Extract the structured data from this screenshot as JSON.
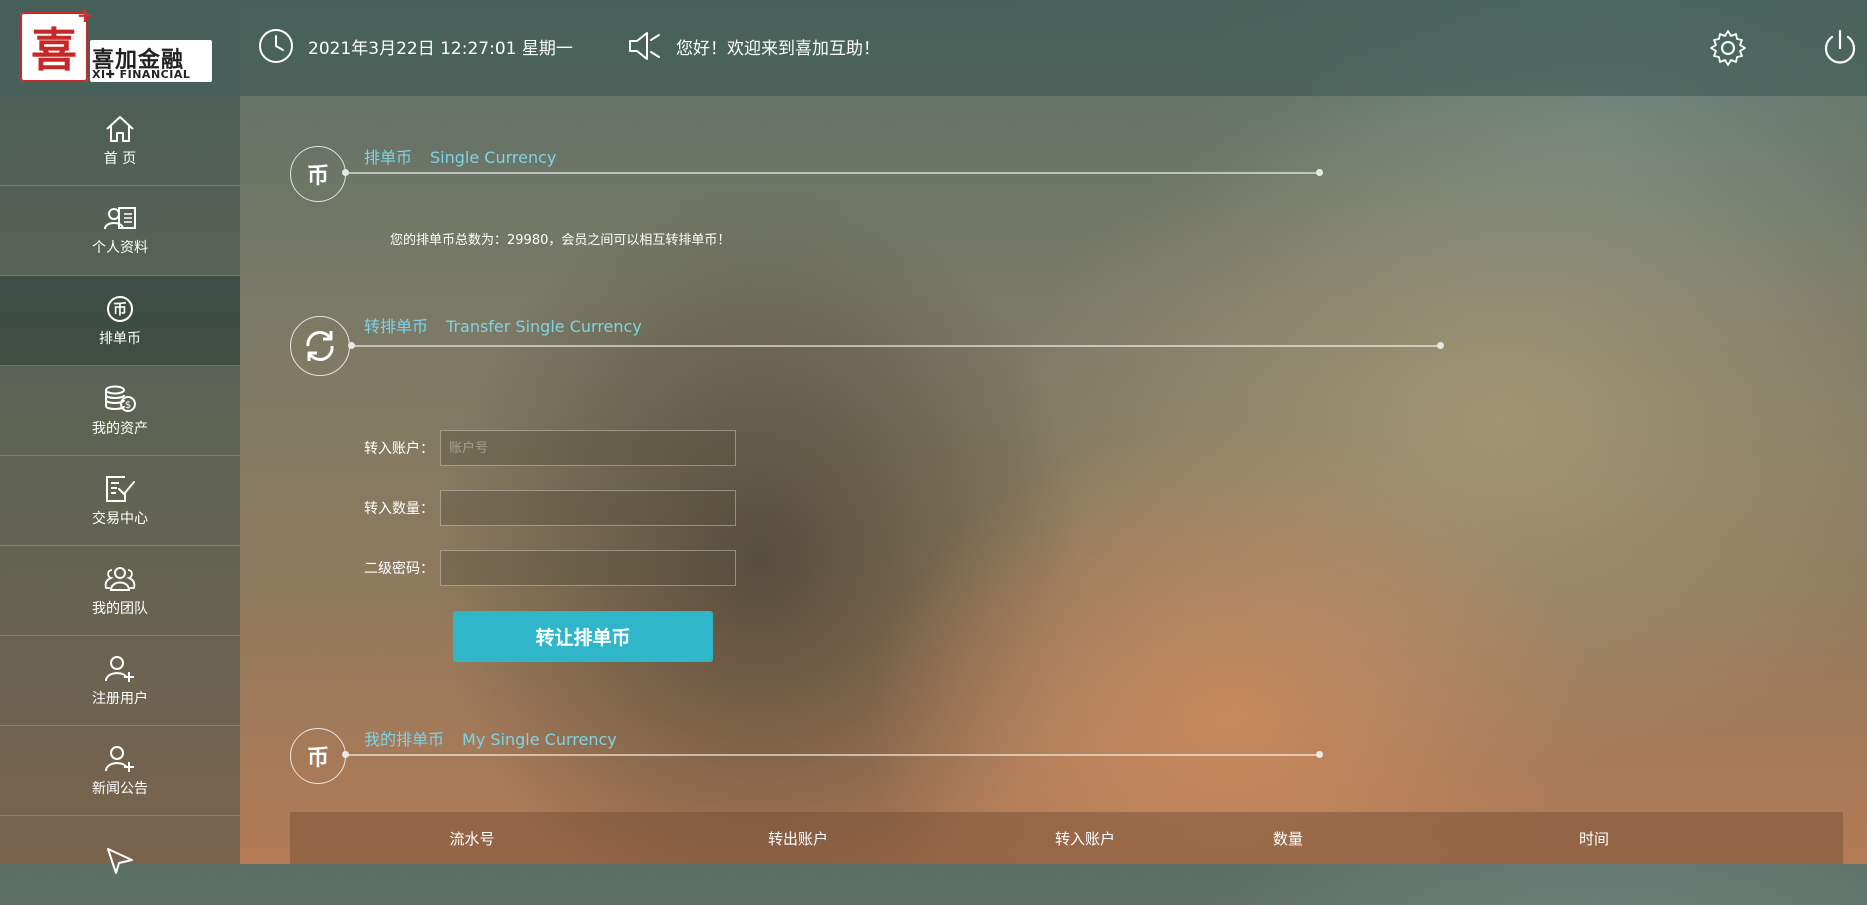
{
  "brand": {
    "cn": "喜加金融",
    "en": "XI✚ FINANCIAL",
    "mark": "喜"
  },
  "header": {
    "datetime": "2021年3月22日 12:27:01 星期一",
    "greeting": "您好！欢迎来到喜加互助！",
    "icons": [
      "clock-icon",
      "speaker-icon",
      "gear-icon",
      "power-icon"
    ]
  },
  "sidebar": {
    "items": [
      {
        "label": "首 页",
        "icon": "home-icon"
      },
      {
        "label": "个人资料",
        "icon": "profile-card-icon"
      },
      {
        "label": "排单币",
        "icon": "coin-icon",
        "active": true
      },
      {
        "label": "我的资产",
        "icon": "assets-coins-icon"
      },
      {
        "label": "交易中心",
        "icon": "trade-check-icon"
      },
      {
        "label": "我的团队",
        "icon": "team-icon"
      },
      {
        "label": "注册用户",
        "icon": "add-user-icon"
      },
      {
        "label": "新闻公告",
        "icon": "news-user-icon"
      }
    ]
  },
  "sections": {
    "single": {
      "cn": "排单币",
      "en": "Single Currency"
    },
    "transfer": {
      "cn": "转排单币",
      "en": "Transfer Single Currency"
    },
    "mine": {
      "cn": "我的排单币",
      "en": "My Single Currency"
    }
  },
  "notice": "您的排单币总数为：29980，会员之间可以相互转排单币！",
  "form": {
    "account_label": "转入账户：",
    "account_placeholder": "账户号",
    "amount_label": "转入数量：",
    "password_label": "二级密码：",
    "submit_label": "转让排单币"
  },
  "table": {
    "columns": [
      "流水号",
      "转出账户",
      "转入账户",
      "数量",
      "时间"
    ]
  },
  "colors": {
    "accent": "#7fd3e6",
    "button": "#2fb7c9",
    "brand_red": "#c62828"
  }
}
